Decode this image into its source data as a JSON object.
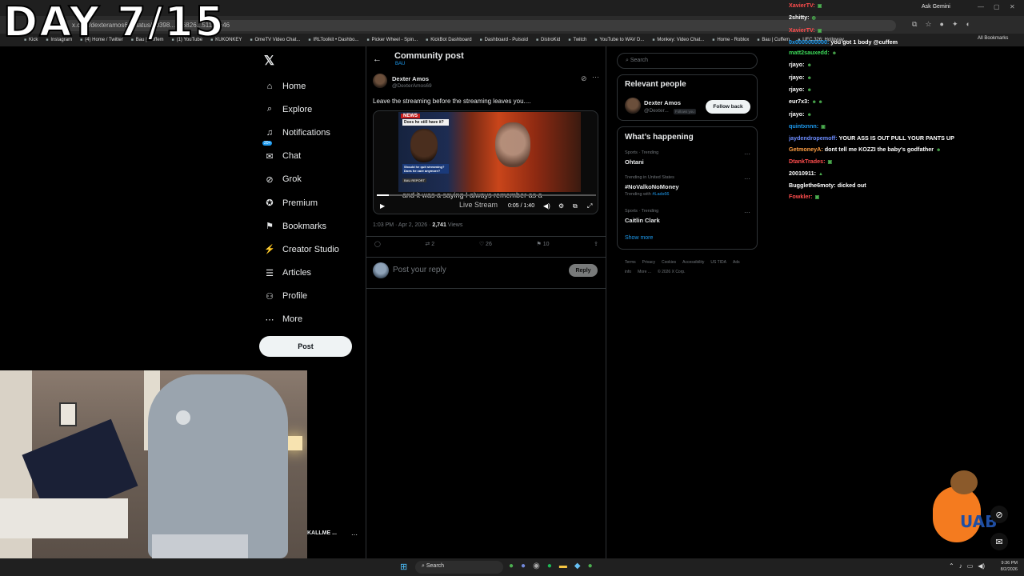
{
  "overlay": {
    "day_counter": "DAY 7/15"
  },
  "browser": {
    "url": "x.com/dexteramos69/status/20398...566826...511?s=46",
    "ask_gemini": "Ask Gemini",
    "bookmarks": [
      "Kick",
      "Instagram",
      "(4) Home / Twitter",
      "Bau | Cuffem",
      "(1) YouTube",
      "KUKONKEY",
      "OmeTV Video Chat...",
      "IRLToolkit • Dashbo...",
      "Picker Wheel - Spin...",
      "KickBot Dashboard",
      "Dashboard - Pulsoid",
      "DistroKid",
      "Twitch",
      "YouTube to WAV D...",
      "Monkey: Video Chat...",
      "Home - Roblox",
      "Bau | Cuffem",
      "UFC 326: Holloway..."
    ],
    "all_bookmarks": "All Bookmarks"
  },
  "nav": {
    "logo": "𝕏",
    "items": [
      {
        "label": "Home",
        "icon": "⌂"
      },
      {
        "label": "Explore",
        "icon": "⌕"
      },
      {
        "label": "Notifications",
        "icon": "♫"
      },
      {
        "label": "Chat",
        "icon": "✉"
      },
      {
        "label": "Grok",
        "icon": "⊘"
      },
      {
        "label": "Premium",
        "icon": "✪"
      },
      {
        "label": "Bookmarks",
        "icon": "⚑"
      },
      {
        "label": "Creator Studio",
        "icon": "⚡"
      },
      {
        "label": "Articles",
        "icon": "☰"
      },
      {
        "label": "Profile",
        "icon": "⚇"
      },
      {
        "label": "More",
        "icon": "⋯"
      }
    ],
    "chat_badge": "20+",
    "post_label": "Post",
    "account_name": "KALLME ...",
    "account_more": "⋯"
  },
  "post": {
    "header_title": "Community post",
    "header_sub": "BAU",
    "author_name": "Dexter Amos",
    "author_handle": "@DexterAmos69",
    "text": "Leave the streaming before the streaming leaves you....",
    "video": {
      "news_tag": "NEWS",
      "headline": "Does he still have it?",
      "question": "Should he quit streaming? Does he care anymore?",
      "tag2": "BAU REPORT",
      "caption": "and it was a saying I always remember as a",
      "caption2": "Live Stream",
      "time": "0:05 / 1:40",
      "progress": 0.054
    },
    "timestamp": "1:03 PM · Apr 2, 2026 · ",
    "views_count": "2,741",
    "views_label": " Views",
    "retweets": "2",
    "likes": "26",
    "bookmarks": "10",
    "reply_placeholder": "Post your reply",
    "reply_button": "Reply"
  },
  "sidebar": {
    "search_placeholder": "Search",
    "relevant_title": "Relevant people",
    "relevant_name": "Dexter Amos",
    "relevant_handle": "@Dexter...",
    "follows_you": "Follows you",
    "follow_back": "Follow back",
    "happening_title": "What’s happening",
    "trends": [
      {
        "context": "Sports · Trending",
        "name": "Ohtani",
        "with": ""
      },
      {
        "context": "Trending in United States",
        "name": "#NoValkoNoMoney",
        "with": "#Lads66"
      },
      {
        "context": "Sports · Trending",
        "name": "Caitlin Clark",
        "with": ""
      }
    ],
    "trending_with": "Trending with ",
    "show_more": "Show more",
    "footer": [
      "Terms",
      "Privacy",
      "Cookies",
      "Accessibility",
      "US TIDA",
      "Ads info",
      "More ...",
      "© 2026 X Corp."
    ]
  },
  "chat": [
    {
      "user": "XavierTV:",
      "msg": "",
      "color": "#ff4d4d",
      "emote": "▣"
    },
    {
      "user": "2shitty:",
      "msg": "",
      "color": "#ffffff",
      "emote": "◍"
    },
    {
      "user": "XavierTV:",
      "msg": "",
      "color": "#ff4d4d",
      "emote": "▣"
    },
    {
      "user": "0x0000000000:",
      "msg": "you got 1 body @cuffem",
      "color": "#1d9bf0",
      "emote": ""
    },
    {
      "user": "matt2sauxedd:",
      "msg": "",
      "color": "#3ddc5a",
      "emote": "☻"
    },
    {
      "user": "rjayo:",
      "msg": "",
      "color": "#ffffff",
      "emote": "☻"
    },
    {
      "user": "rjayo:",
      "msg": "",
      "color": "#ffffff",
      "emote": "☻"
    },
    {
      "user": "rjayo:",
      "msg": "",
      "color": "#ffffff",
      "emote": "☻"
    },
    {
      "user": "eur7x3:",
      "msg": "",
      "color": "#ffffff",
      "emote": "☻ ☻"
    },
    {
      "user": "rjayo:",
      "msg": "",
      "color": "#ffffff",
      "emote": "☻"
    },
    {
      "user": "quintxnnn:",
      "msg": "",
      "color": "#1d9bf0",
      "emote": "▣"
    },
    {
      "user": "jaydendropemoff:",
      "msg": "YOUR ASS IS OUT PULL YOUR PANTS UP",
      "color": "#6c8cff",
      "emote": ""
    },
    {
      "user": "GetmoneyA:",
      "msg": "dont tell me KOZZI the baby's godfather",
      "color": "#ff9f43",
      "emote": "☻"
    },
    {
      "user": "DtankTrades:",
      "msg": "",
      "color": "#ff4d4d",
      "emote": "▣"
    },
    {
      "user": "20010911:",
      "msg": "",
      "color": "#ffffff",
      "emote": "▲"
    },
    {
      "user": "Bugglethe6moty:",
      "msg": "dicked out",
      "color": "#ffffff",
      "emote": ""
    },
    {
      "user": "Fowkler:",
      "msg": "",
      "color": "#ff4d4d",
      "emote": "▣"
    }
  ],
  "mascot": {
    "text": "UAB"
  },
  "taskbar": {
    "search": "Search",
    "time": "9:36 PM",
    "date": "8/2/2026"
  },
  "colors": {
    "accent": "#1d9bf0",
    "background": "#000000"
  }
}
